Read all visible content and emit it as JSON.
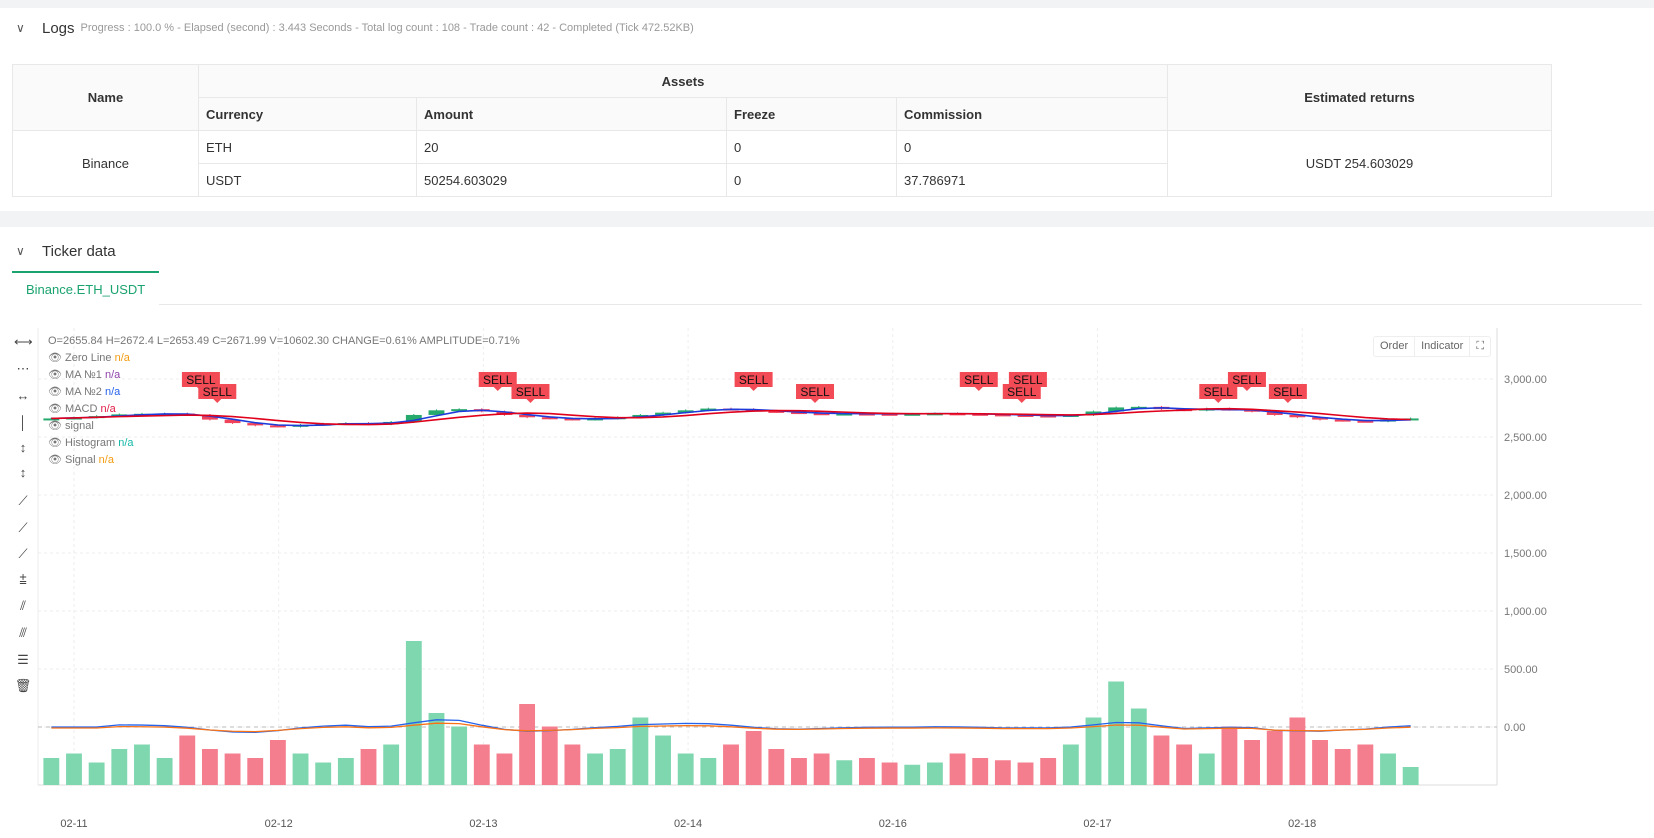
{
  "logs": {
    "title": "Logs",
    "status": "Progress : 100.0 % - Elapsed (second) : 3.443  Seconds - Total log count : 108 - Trade count : 42 - Completed (Tick 472.52KB)"
  },
  "table": {
    "name_h": "Name",
    "assets_h": "Assets",
    "returns_h": "Estimated returns",
    "cols": [
      "Currency",
      "Amount",
      "Freeze",
      "Commission"
    ],
    "exchange": "Binance",
    "rows": [
      [
        "ETH",
        "20",
        "0",
        "0"
      ],
      [
        "USDT",
        "50254.603029",
        "0",
        "37.786971"
      ]
    ],
    "returns": "USDT 254.603029"
  },
  "ticker": {
    "title": "Ticker data",
    "tab": "Binance.ETH_USDT"
  },
  "chart": {
    "ohlc": "O=2655.84 H=2672.4 L=2653.49 C=2671.99 V=10602.30 CHANGE=0.61% AMPLITUDE=0.71%",
    "legend": [
      {
        "name": "Zero Line",
        "val": "n/a",
        "color": "#f39c12"
      },
      {
        "name": "MA №1",
        "val": "n/a",
        "color": "#8e44ad"
      },
      {
        "name": "MA №2",
        "val": "n/a",
        "color": "#2563eb"
      },
      {
        "name": "MACD",
        "val": "n/a",
        "color": "#e11d48"
      },
      {
        "name": "signal",
        "val": "",
        "color": "#777"
      },
      {
        "name": "Histogram",
        "val": "n/a",
        "color": "#14b8a6"
      },
      {
        "name": "Signal",
        "val": "n/a",
        "color": "#f39c12"
      }
    ],
    "order": "Order",
    "indicator": "Indicator"
  },
  "chart_data": {
    "type": "candlestick",
    "x_labels": [
      "02-11",
      "02-12",
      "02-13",
      "02-14",
      "02-16",
      "02-17",
      "02-18"
    ],
    "y_ticks": [
      "3,000.00",
      "2,500.00",
      "2,000.00",
      "1,500.00",
      "1,000.00",
      "500.00",
      "0.00"
    ],
    "ylim": [
      0,
      3300
    ],
    "closes": [
      2660,
      2668,
      2680,
      2695,
      2700,
      2702,
      2690,
      2650,
      2620,
      2600,
      2590,
      2605,
      2615,
      2620,
      2610,
      2630,
      2690,
      2730,
      2740,
      2720,
      2690,
      2670,
      2660,
      2650,
      2660,
      2670,
      2690,
      2710,
      2730,
      2745,
      2740,
      2725,
      2715,
      2705,
      2700,
      2702,
      2700,
      2698,
      2700,
      2704,
      2700,
      2695,
      2690,
      2685,
      2680,
      2690,
      2720,
      2755,
      2760,
      2740,
      2730,
      2745,
      2735,
      2720,
      2690,
      2670,
      2650,
      2640,
      2635,
      2650,
      2660
    ],
    "volumes": [
      60,
      70,
      50,
      80,
      90,
      60,
      110,
      80,
      70,
      60,
      100,
      70,
      50,
      60,
      80,
      90,
      320,
      160,
      130,
      90,
      70,
      180,
      130,
      90,
      70,
      80,
      150,
      110,
      70,
      60,
      90,
      120,
      80,
      60,
      70,
      55,
      60,
      50,
      45,
      50,
      70,
      60,
      55,
      50,
      60,
      90,
      150,
      230,
      170,
      110,
      90,
      70,
      130,
      100,
      120,
      150,
      100,
      80,
      90,
      70,
      40
    ],
    "sell_labels": [
      0.62,
      0.7,
      2.07,
      2.23,
      3.32,
      3.62,
      4.42,
      4.63,
      4.66,
      5.59,
      5.73,
      5.93
    ]
  }
}
